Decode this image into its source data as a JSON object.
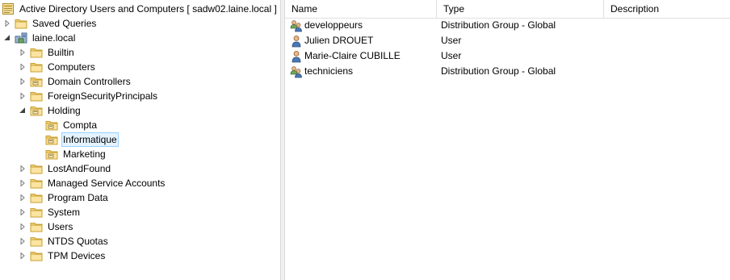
{
  "tree": {
    "root_label": "Active Directory Users and Computers [ sadw02.laine.local ]",
    "saved_queries": "Saved Queries",
    "domain": "laine.local",
    "children": [
      {
        "label": "Builtin",
        "type": "folder",
        "state": "collapsed"
      },
      {
        "label": "Computers",
        "type": "folder",
        "state": "collapsed"
      },
      {
        "label": "Domain Controllers",
        "type": "ou",
        "state": "collapsed"
      },
      {
        "label": "ForeignSecurityPrincipals",
        "type": "folder",
        "state": "collapsed"
      },
      {
        "label": "Holding",
        "type": "ou",
        "state": "expanded"
      },
      {
        "label": "Compta",
        "type": "ou",
        "state": "none"
      },
      {
        "label": "Informatique",
        "type": "ou",
        "state": "none",
        "selected": true
      },
      {
        "label": "Marketing",
        "type": "ou",
        "state": "none"
      },
      {
        "label": "LostAndFound",
        "type": "folder",
        "state": "collapsed"
      },
      {
        "label": "Managed Service Accounts",
        "type": "folder",
        "state": "collapsed"
      },
      {
        "label": "Program Data",
        "type": "folder",
        "state": "collapsed"
      },
      {
        "label": "System",
        "type": "folder",
        "state": "collapsed"
      },
      {
        "label": "Users",
        "type": "folder",
        "state": "collapsed"
      },
      {
        "label": "NTDS Quotas",
        "type": "folder",
        "state": "collapsed"
      },
      {
        "label": "TPM Devices",
        "type": "folder",
        "state": "collapsed"
      }
    ]
  },
  "list": {
    "columns": [
      "Name",
      "Type",
      "Description"
    ],
    "rows": [
      {
        "name": "developpeurs",
        "type": "Distribution Group - Global",
        "description": "",
        "icon": "group-icon"
      },
      {
        "name": "Julien DROUET",
        "type": "User",
        "description": "",
        "icon": "user-icon"
      },
      {
        "name": "Marie-Claire CUBILLE",
        "type": "User",
        "description": "",
        "icon": "user-icon"
      },
      {
        "name": "techniciens",
        "type": "Distribution Group - Global",
        "description": "",
        "icon": "group-icon"
      }
    ]
  },
  "colors": {
    "folder": "#e8c25a",
    "selection_bg": "#e5f3ff",
    "selection_border": "#99d1ff"
  }
}
